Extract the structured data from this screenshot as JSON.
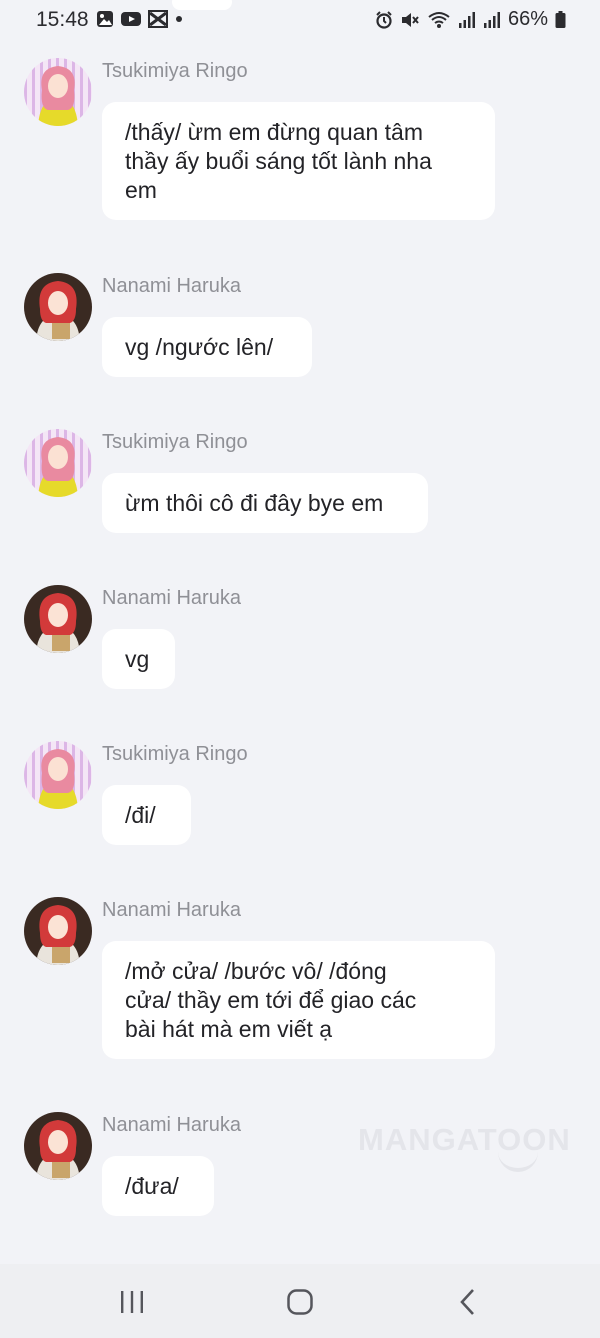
{
  "status_bar": {
    "time": "15:48",
    "battery": "66%",
    "icons_left": [
      "gallery-icon",
      "youtube-icon",
      "capcut-icon",
      "dot-icon"
    ],
    "icons_right": [
      "alarm-icon",
      "mute-icon",
      "wifi-icon",
      "signal-icon",
      "signal-icon",
      "battery-icon"
    ]
  },
  "messages": [
    {
      "sender": "Tsukimiya Ringo",
      "avatar": "ringo-avatar",
      "lines": [
        "/thấy/ ừm em đừng quan tâm",
        "thầy ấy buổi sáng tốt lành nha",
        "em"
      ]
    },
    {
      "sender": "Nanami Haruka",
      "avatar": "haruka-avatar",
      "lines": [
        "vg /ngước lên/"
      ]
    },
    {
      "sender": "Tsukimiya Ringo",
      "avatar": "ringo-avatar",
      "lines": [
        "ừm thôi cô đi đây bye em"
      ]
    },
    {
      "sender": "Nanami Haruka",
      "avatar": "haruka-avatar",
      "lines": [
        "vg"
      ]
    },
    {
      "sender": "Tsukimiya Ringo",
      "avatar": "ringo-avatar",
      "lines": [
        "/đi/"
      ]
    },
    {
      "sender": "Nanami Haruka",
      "avatar": "haruka-avatar",
      "lines": [
        "/mở cửa/ /bước vô/ /đóng",
        "cửa/ thầy em tới để giao các",
        "bài hát mà em viết ạ"
      ]
    },
    {
      "sender": "Nanami Haruka",
      "avatar": "haruka-avatar",
      "lines": [
        "/đưa/"
      ]
    }
  ],
  "watermark": "MANGATOON",
  "nav_bar": {
    "recents": "recents-icon",
    "home": "home-icon",
    "back": "back-icon"
  },
  "colors": {
    "background": "#f2f3f7",
    "bubble": "#ffffff",
    "name_text": "#8f9096",
    "message_text": "#232327"
  }
}
